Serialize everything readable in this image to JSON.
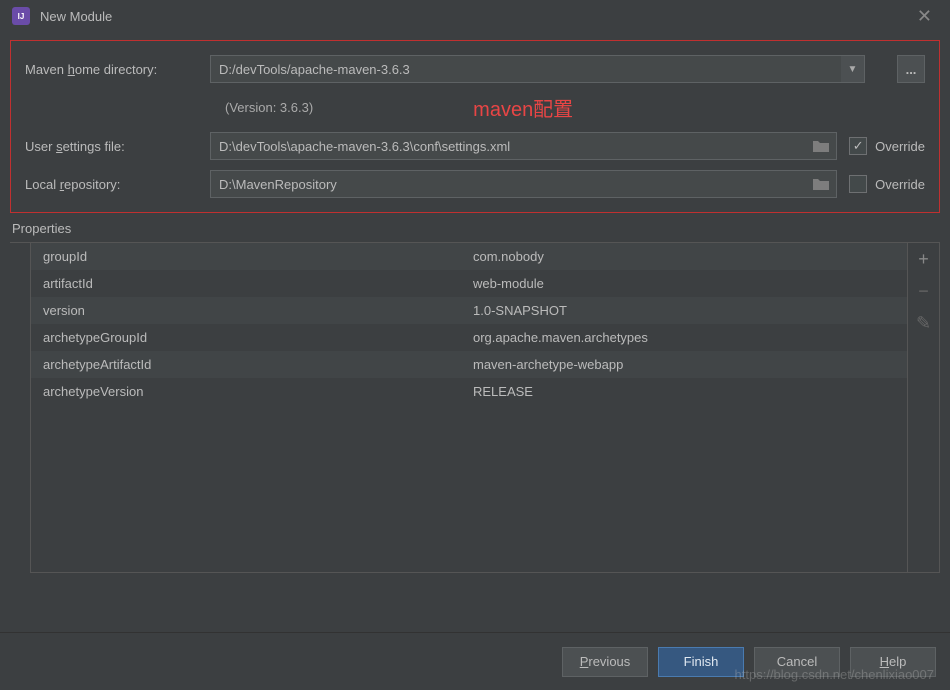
{
  "titlebar": {
    "title": "New Module"
  },
  "maven": {
    "homeLabelPre": "Maven ",
    "homeLabelU": "h",
    "homeLabelPost": "ome directory:",
    "homeValue": "D:/devTools/apache-maven-3.6.3",
    "version": "(Version: 3.6.3)",
    "redLabel": "maven配置",
    "settingsLabelPre": "User ",
    "settingsLabelU": "s",
    "settingsLabelPost": "ettings file:",
    "settingsValue": "D:\\devTools\\apache-maven-3.6.3\\conf\\settings.xml",
    "repoLabelPre": "Local ",
    "repoLabelU": "r",
    "repoLabelPost": "epository:",
    "repoValue": "D:\\MavenRepository",
    "overrideLabel": "Override",
    "settingsOverride": true,
    "repoOverride": false
  },
  "properties": {
    "title": "Properties",
    "rows": [
      {
        "key": "groupId",
        "value": "com.nobody"
      },
      {
        "key": "artifactId",
        "value": "web-module"
      },
      {
        "key": "version",
        "value": "1.0-SNAPSHOT"
      },
      {
        "key": "archetypeGroupId",
        "value": "org.apache.maven.archetypes"
      },
      {
        "key": "archetypeArtifactId",
        "value": "maven-archetype-webapp"
      },
      {
        "key": "archetypeVersion",
        "value": "RELEASE"
      }
    ]
  },
  "buttons": {
    "previousPre": "",
    "previousU": "P",
    "previousPost": "revious",
    "finish": "Finish",
    "cancel": "Cancel",
    "helpPre": "",
    "helpU": "H",
    "helpPost": "elp"
  },
  "watermark": "https://blog.csdn.net/chenlixiao007"
}
